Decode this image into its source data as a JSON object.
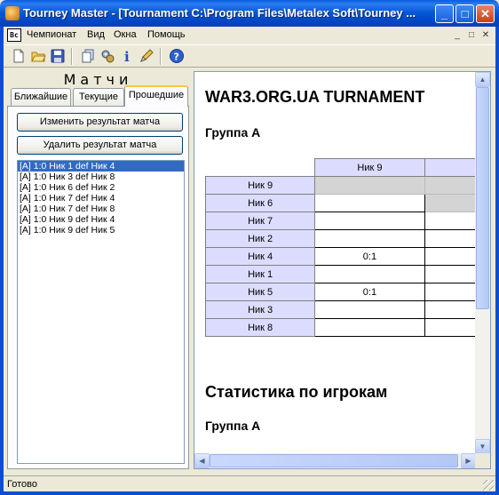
{
  "window": {
    "title": "Tourney Master - [Tournament C:\\Program Files\\Metalex Soft\\Tourney ...",
    "minimize": "_",
    "maximize": "□",
    "close": "✕"
  },
  "menubar": {
    "app_icon": "Bc",
    "items": [
      "Чемпионат",
      "Вид",
      "Окна",
      "Помощь"
    ],
    "mdi_buttons": [
      "_",
      "□",
      "✕"
    ]
  },
  "toolbar": {
    "icons": [
      "new-file-icon",
      "open-folder-icon",
      "save-disk-icon",
      "copy-pages-icon",
      "settings-gears-icon",
      "info-icon",
      "edit-pencil-icon",
      "help-icon"
    ]
  },
  "left_panel": {
    "title": "Матчи",
    "tabs": [
      "Ближайшие",
      "Текущие",
      "Прошедшие"
    ],
    "active_tab": "Прошедшие",
    "buttons": {
      "edit_result": "Изменить результат матча",
      "delete_result": "Удалить результат матча"
    },
    "matches": [
      "[A] 1:0 Ник 1 def Ник 4",
      "[A] 1:0 Ник 3 def Ник 8",
      "[A] 1:0 Ник 6 def Ник 2",
      "[A] 1:0 Ник 7 def Ник 4",
      "[A] 1:0 Ник 7 def Ник 8",
      "[A] 1:0 Ник 9 def Ник 4",
      "[A] 1:0 Ник 9 def Ник 5"
    ],
    "selected_index": 0
  },
  "document": {
    "heading": "WAR3.ORG.UA TURNAMENT",
    "group_heading": "Группа A",
    "table": {
      "col_headers": [
        "Ник 9",
        ""
      ],
      "rows": [
        {
          "name": "Ник 9",
          "cells": [
            "",
            ""
          ],
          "diag": [
            true,
            true
          ]
        },
        {
          "name": "Ник 6",
          "cells": [
            "",
            ""
          ],
          "diag": [
            false,
            true
          ]
        },
        {
          "name": "Ник 7",
          "cells": [
            "",
            ""
          ],
          "diag": [
            false,
            false
          ]
        },
        {
          "name": "Ник 2",
          "cells": [
            "",
            ""
          ],
          "diag": [
            false,
            false
          ]
        },
        {
          "name": "Ник 4",
          "cells": [
            "0:1",
            ""
          ],
          "diag": [
            false,
            false
          ]
        },
        {
          "name": "Ник 1",
          "cells": [
            "",
            ""
          ],
          "diag": [
            false,
            false
          ]
        },
        {
          "name": "Ник 5",
          "cells": [
            "0:1",
            ""
          ],
          "diag": [
            false,
            false
          ]
        },
        {
          "name": "Ник 3",
          "cells": [
            "",
            ""
          ],
          "diag": [
            false,
            false
          ]
        },
        {
          "name": "Ник 8",
          "cells": [
            "",
            ""
          ],
          "diag": [
            false,
            false
          ]
        }
      ]
    },
    "stats_heading": "Статистика по игрокам",
    "stats_group_heading": "Группа A"
  },
  "statusbar": {
    "text": "Готово"
  }
}
